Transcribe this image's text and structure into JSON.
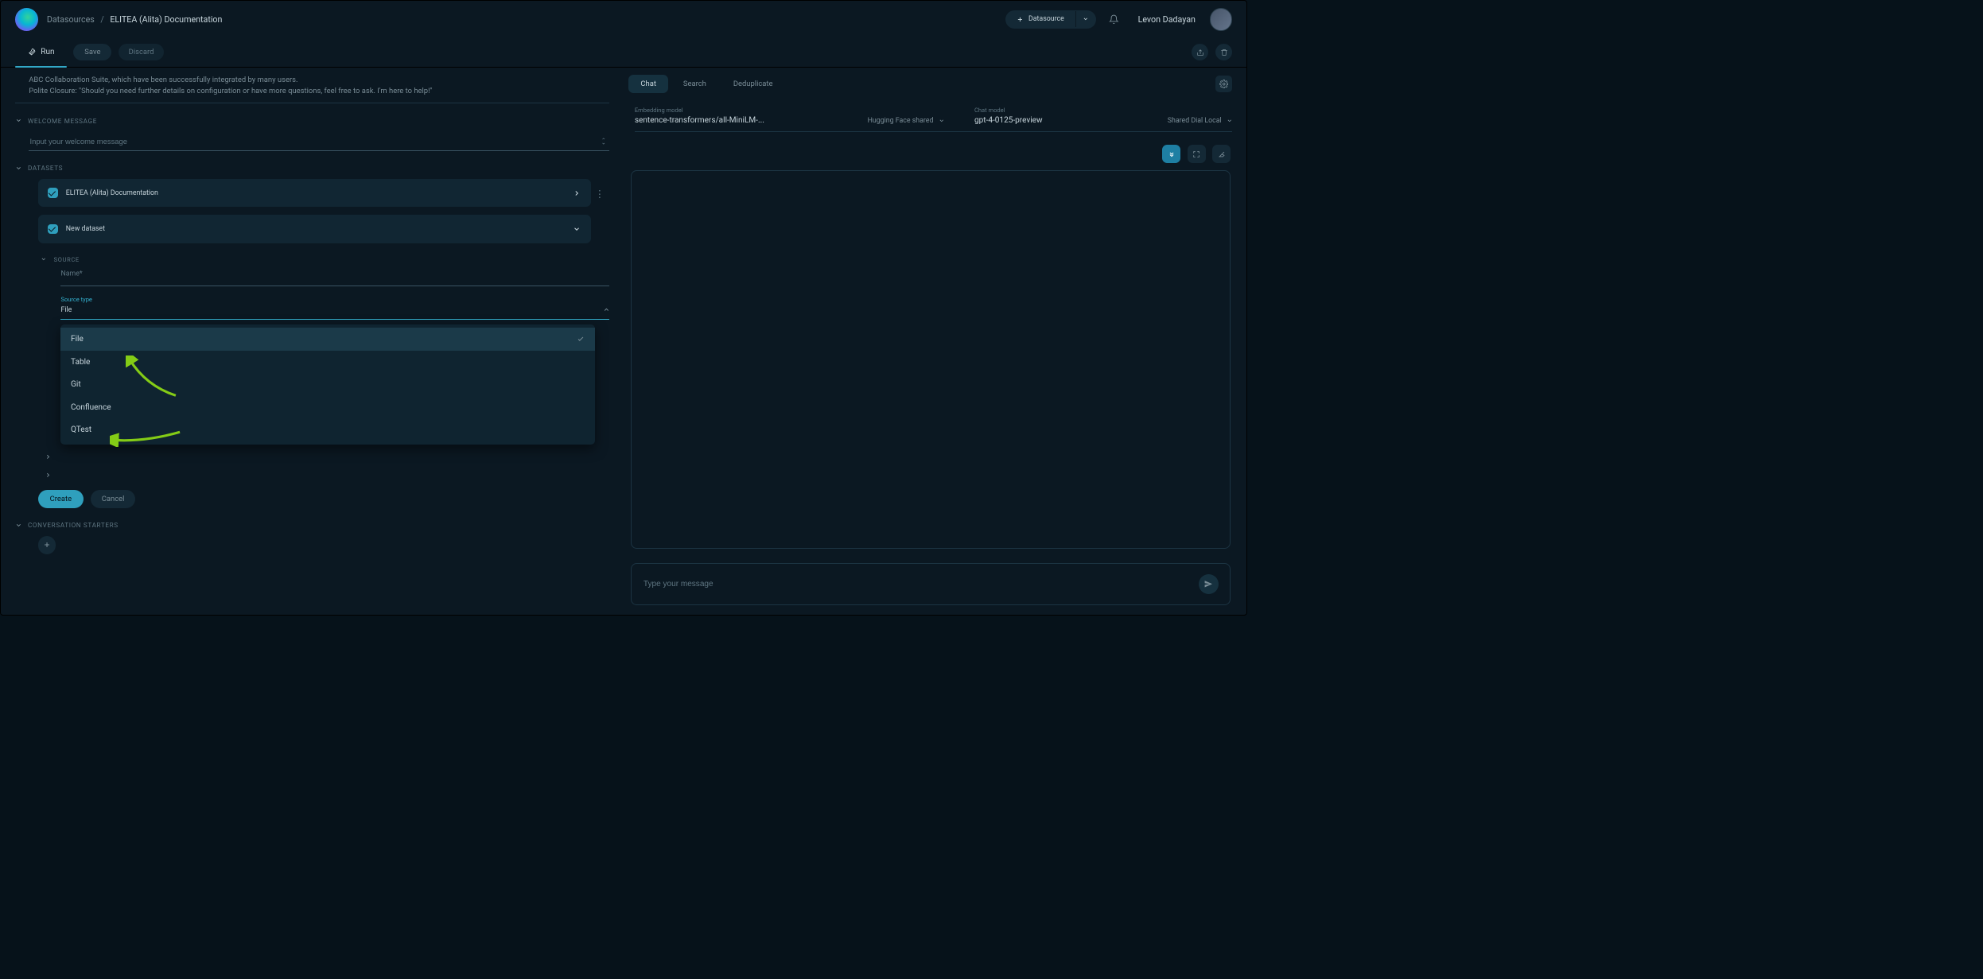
{
  "header": {
    "crumb_root": "Datasources",
    "crumb_current": "ELITEA (Alita) Documentation",
    "datasource_btn": "Datasource",
    "username": "Levon Dadayan"
  },
  "toolbar": {
    "run": "Run",
    "save": "Save",
    "discard": "Discard"
  },
  "note_line1": "ABC Collaboration Suite, which have been successfully integrated by many users.",
  "note_line2": "Polite Closure: \"Should you need further details on configuration or have more questions, feel free to ask. I'm here to help!\"",
  "sections": {
    "welcome": "WELCOME MESSAGE",
    "datasets": "DATASETS",
    "source": "SOURCE",
    "starters": "CONVERSATION STARTERS"
  },
  "welcome_placeholder": "Input your welcome message",
  "datasets": [
    {
      "label": "ELITEA (Alita) Documentation"
    },
    {
      "label": "New dataset"
    }
  ],
  "source_form": {
    "name_label": "Name",
    "required_marker": "*",
    "type_label": "Source type",
    "type_value": "File",
    "options": [
      "File",
      "Table",
      "Git",
      "Confluence",
      "QTest"
    ]
  },
  "buttons": {
    "create": "Create",
    "cancel": "Cancel"
  },
  "right": {
    "tabs": {
      "chat": "Chat",
      "search": "Search",
      "dedup": "Deduplicate"
    },
    "embed_label": "Embedding model",
    "embed_value": "sentence-transformers/all-MiniLM-...",
    "embed_right": "Hugging Face shared",
    "chat_label": "Chat model",
    "chat_value": "gpt-4-0125-preview",
    "chat_right": "Shared Dial Local",
    "message_placeholder": "Type your message"
  }
}
